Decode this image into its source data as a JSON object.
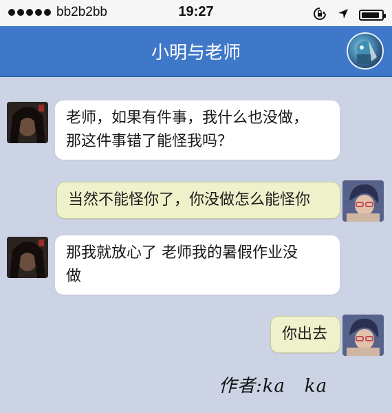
{
  "status_bar": {
    "carrier": "bb2b2bb",
    "time": "19:27",
    "battery_percent": 90
  },
  "nav": {
    "title": "小明与老师"
  },
  "messages": [
    {
      "sender": "boy",
      "side": "left",
      "lines": [
        "老师，如果有件事，我什么也没做，",
        "那这件事错了能怪我吗？"
      ]
    },
    {
      "sender": "teacher",
      "side": "right",
      "lines": [
        "当然不能怪你了，你没做怎么能怪你"
      ]
    },
    {
      "sender": "boy",
      "side": "left",
      "lines": [
        "那我就放心了 老师我的暑假作业没",
        "做"
      ]
    },
    {
      "sender": "teacher",
      "side": "right",
      "lines": [
        "你出去"
      ]
    }
  ],
  "signature": "作者:ka   ka",
  "colors": {
    "nav_bar": "#3f78c9",
    "chat_background": "#ccd3e4",
    "left_bubble": "#ffffff",
    "right_bubble": "#eff1cb"
  },
  "icons": {
    "signal": "signal-dots-icon",
    "rotation_lock": "rotation-lock-icon",
    "location": "location-arrow-icon",
    "battery": "battery-icon"
  }
}
